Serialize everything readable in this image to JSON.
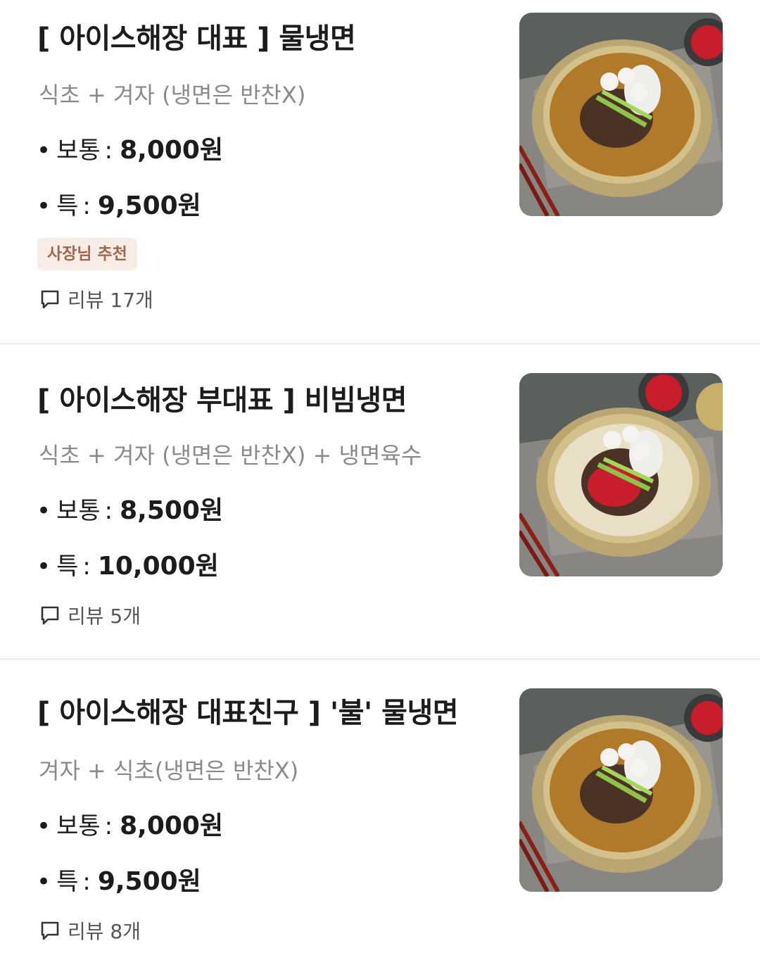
{
  "items": [
    {
      "title": "[ 아이스해장 대표 ] 물냉면",
      "description": "식초 + 겨자 (냉면은 반찬X)",
      "prices": [
        {
          "bullet": "•",
          "label": "보통",
          "sep": ":",
          "value": "8,000원"
        },
        {
          "bullet": "•",
          "label": "특",
          "sep": ":",
          "value": "9,500원"
        }
      ],
      "badge": "사장님 추천",
      "review": "리뷰 17개",
      "image": {
        "dish": "mul-naengmyeon",
        "sauce_color": "#c81d2a",
        "broth_color": "#b07a2a"
      }
    },
    {
      "title": "[ 아이스해장 부대표 ] 비빔냉면",
      "description": "식초 + 겨자 (냉면은 반찬X) + 냉면육수",
      "prices": [
        {
          "bullet": "•",
          "label": "보통",
          "sep": ":",
          "value": "8,500원"
        },
        {
          "bullet": "•",
          "label": "특",
          "sep": ":",
          "value": "10,000원"
        }
      ],
      "review": "리뷰 5개",
      "image": {
        "dish": "bibim-naengmyeon",
        "sauce_color": "#c81d2a",
        "broth_color": "#c9b06a"
      }
    },
    {
      "title": "[ 아이스해장 대표친구 ] '불' 물냉면",
      "description": "겨자 + 식초(냉면은 반찬X)",
      "prices": [
        {
          "bullet": "•",
          "label": "보통",
          "sep": ":",
          "value": "8,000원"
        },
        {
          "bullet": "•",
          "label": "특",
          "sep": ":",
          "value": "9,500원"
        }
      ],
      "review": "리뷰 8개",
      "image": {
        "dish": "mul-naengmyeon",
        "sauce_color": "#c81d2a",
        "broth_color": "#b07a2a"
      }
    }
  ]
}
